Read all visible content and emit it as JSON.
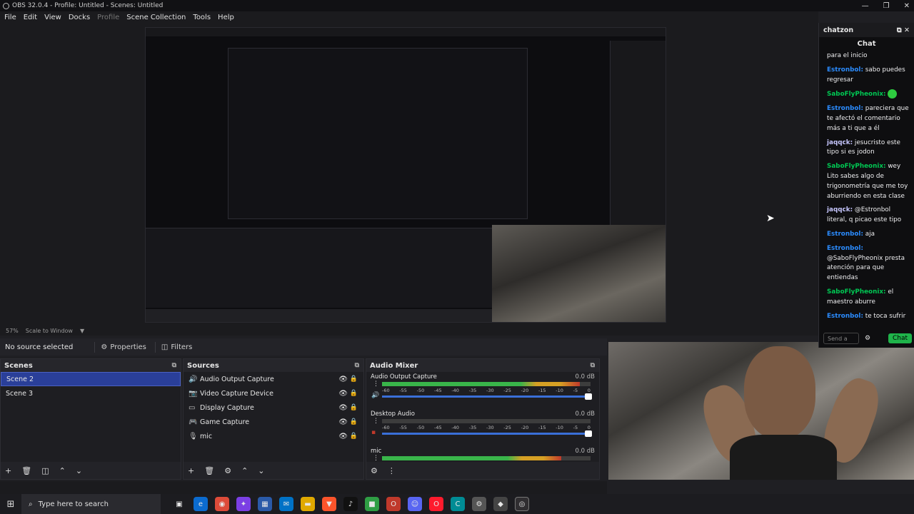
{
  "window": {
    "title": "OBS 32.0.4 - Profile: Untitled - Scenes: Untitled"
  },
  "menu": [
    "File",
    "Edit",
    "View",
    "Docks",
    "Profile",
    "Scene Collection",
    "Tools",
    "Help"
  ],
  "preview": {
    "zoom": "57%",
    "scale_mode": "Scale to Window"
  },
  "source_bar": {
    "status": "No source selected",
    "properties": "Properties",
    "filters": "Filters"
  },
  "scenes": {
    "title": "Scenes",
    "items": [
      "Scene 2",
      "Scene 3"
    ],
    "selected": "Scene 2"
  },
  "sources": {
    "title": "Sources",
    "items": [
      {
        "name": "Audio Output Capture",
        "icon": "speaker-icon"
      },
      {
        "name": "Video Capture Device",
        "icon": "camera-icon"
      },
      {
        "name": "Display Capture",
        "icon": "monitor-icon"
      },
      {
        "name": "Game Capture",
        "icon": "gamepad-icon"
      },
      {
        "name": "mic",
        "icon": "microphone-icon"
      }
    ]
  },
  "mixer": {
    "title": "Audio Mixer",
    "ticks": [
      "-60",
      "-55",
      "-50",
      "-45",
      "-40",
      "-35",
      "-30",
      "-25",
      "-20",
      "-15",
      "-10",
      "-5",
      "0"
    ],
    "tracks": [
      {
        "name": "Audio Output Capture",
        "db": "0.0 dB",
        "level": 0.95,
        "muted": false
      },
      {
        "name": "Desktop Audio",
        "db": "0.0 dB",
        "level": 0.0,
        "muted": true
      },
      {
        "name": "mic",
        "db": "0.0 dB",
        "level": 0.86,
        "muted": false
      }
    ]
  },
  "chat": {
    "window": "chatzon",
    "title": "Chat",
    "partial": "para el inicio",
    "messages": [
      {
        "user": "Estronbol:",
        "text": " sabo puedes regresar",
        "cls": "u1"
      },
      {
        "user": "SaboFlyPheonix:",
        "text": "",
        "cls": "u2",
        "emote": true
      },
      {
        "user": "Estronbol:",
        "text": " pareciera que te afectó el comentario más a ti que a él",
        "cls": "u1"
      },
      {
        "user": "jaqqck:",
        "text": " jesucristo este tipo si es jodon",
        "cls": "u3"
      },
      {
        "user": "SaboFlyPheonix:",
        "text": " wey Lito sabes algo de trigonometría que me toy aburriendo en esta clase",
        "cls": "u2"
      },
      {
        "user": "jaqqck:",
        "text": " @Estronbol literal, q picao este tipo",
        "cls": "u3"
      },
      {
        "user": "Estronbol:",
        "text": " aja",
        "cls": "u1"
      },
      {
        "user": "Estronbol:",
        "text": " @SaboFlyPheonix presta atención para que entiendas",
        "cls": "u1"
      },
      {
        "user": "SaboFlyPheonix:",
        "text": " el maestro aburre",
        "cls": "u2"
      },
      {
        "user": "Estronbol:",
        "text": " te toca sufrir",
        "cls": "u1"
      }
    ],
    "input_placeholder": "Send a",
    "send_button": "Chat"
  },
  "taskbar": {
    "search_placeholder": "Type here to search"
  }
}
